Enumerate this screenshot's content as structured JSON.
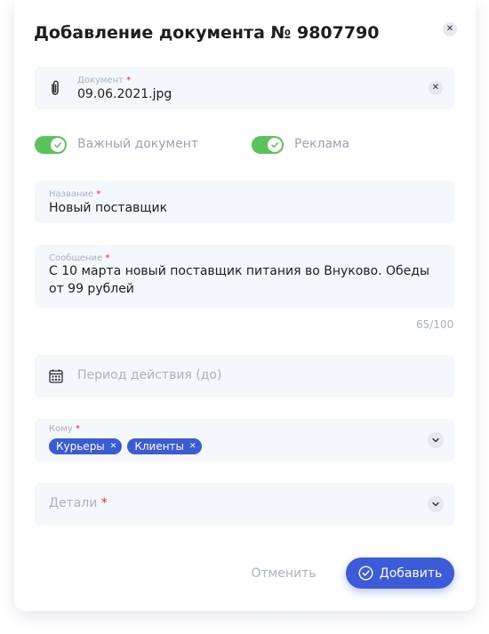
{
  "modal": {
    "title": "Добавление документа № 9807790",
    "close_icon": "close-icon"
  },
  "document_field": {
    "label": "Документ",
    "required_mark": "*",
    "value": "09.06.2021.jpg",
    "icon": "paperclip-icon",
    "clear_icon": "clear-icon"
  },
  "toggles": [
    {
      "label": "Важный документ",
      "on": true,
      "color": "#5cc25a"
    },
    {
      "label": "Реклама",
      "on": true,
      "color": "#5cc25a"
    }
  ],
  "name_field": {
    "label": "Название",
    "required_mark": "*",
    "value": "Новый поставщик"
  },
  "message_field": {
    "label": "Сообщение",
    "required_mark": "*",
    "value_line1": "С 10 марта новый поставщик питания во Внуково. Обеды",
    "value_line2": "от 99 рублей",
    "counter": "65/100"
  },
  "period_field": {
    "placeholder": "Период действия (до)",
    "icon": "calendar-icon"
  },
  "recipients_field": {
    "label": "Кому",
    "required_mark": "*",
    "chips": [
      "Курьеры",
      "Клиенты"
    ],
    "chip_remove_icon": "chip-remove-icon",
    "dropdown_icon": "chevron-down-icon"
  },
  "details_field": {
    "placeholder": "Детали",
    "required_mark": "*",
    "dropdown_icon": "chevron-down-icon"
  },
  "footer": {
    "cancel_label": "Отменить",
    "add_label": "Добавить",
    "add_icon": "check-circle-icon"
  },
  "colors": {
    "accent": "#3b5bd8",
    "toggle_on": "#5cc25a",
    "required": "#e02d2d",
    "field_bg": "#f4f7fb"
  }
}
